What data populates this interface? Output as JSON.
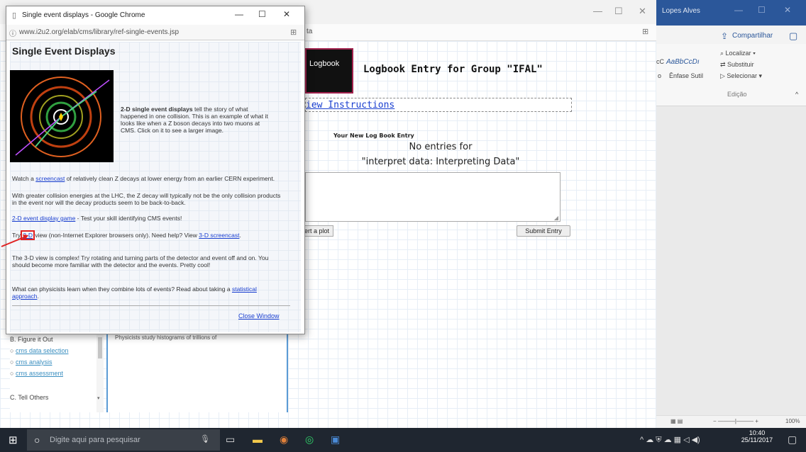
{
  "word": {
    "title": "Lopes Alves",
    "share": "Compartilhar",
    "styles": {
      "sample": "AaBbCcDı",
      "sample_left": "cC",
      "label": "Ênfase Sutil",
      "label_left": "o"
    },
    "find": "Localizar",
    "replace": "Substituir",
    "select": "Selecionar",
    "group_label": "Edição",
    "zoom": "100%"
  },
  "back_browser": {
    "address": "ta",
    "logbook_label": "Logbook",
    "logbook_heading": "Logbook Entry for Group \"IFAL\"",
    "view_instructions": "iew Instructions",
    "new_entry_label": "Your New Log Book Entry",
    "no_entries": "No entries for",
    "interpret": "\"interpret data: Interpreting Data\"",
    "insert_plot": "ert a plot",
    "submit": "Submit Entry",
    "sidebar": {
      "section_b": "B. Figure it Out",
      "items": [
        "cms data selection",
        "cms analysis",
        "cms assessment"
      ],
      "section_c": "C. Tell Others"
    },
    "partial_text": "Physicists study histograms of trillions of"
  },
  "popup": {
    "window_title": "Single event displays - Google Chrome",
    "url": "www.i2u2.org/elab/cms/library/ref-single-events.jsp",
    "heading": "Single Event Displays",
    "intro_bold": "2-D single event displays",
    "intro_rest": " tell the story of what happened in one collision. This is an example of what it looks like when a Z boson decays into two muons at CMS. Click on it to see a larger image.",
    "watch_pre": "Watch a ",
    "watch_link": "screencast",
    "watch_post": " of relatively clean Z decays at lower energy from an earlier CERN experiment.",
    "energies": "With greater collision energies at the LHC, the Z decay will typically not be the only collision products in the event nor will the decay products seem to be back-to-back.",
    "game_link": "2-D event display game",
    "game_text": " - Test your skill identifying CMS events!",
    "try_pre": "Try",
    "try_link": "3-D",
    "try_mid": " view (non-Internet Explorer browsers only). Need help? View ",
    "try_link2": "3-D screencast",
    "try_end": ".",
    "complex": "The 3-D view is complex! Try rotating and turning parts of the detector and event off and on. You should become more familiar with the detector and the events. Pretty cool!",
    "learn_pre": "What can physicists learn when they combine lots of events? Read about taking a ",
    "learn_link": "statistical approach",
    "learn_end": ".",
    "close": "Close Window"
  },
  "taskbar": {
    "search_placeholder": "Digite aqui para pesquisar",
    "time": "10:40",
    "date": "25/11/2017"
  }
}
